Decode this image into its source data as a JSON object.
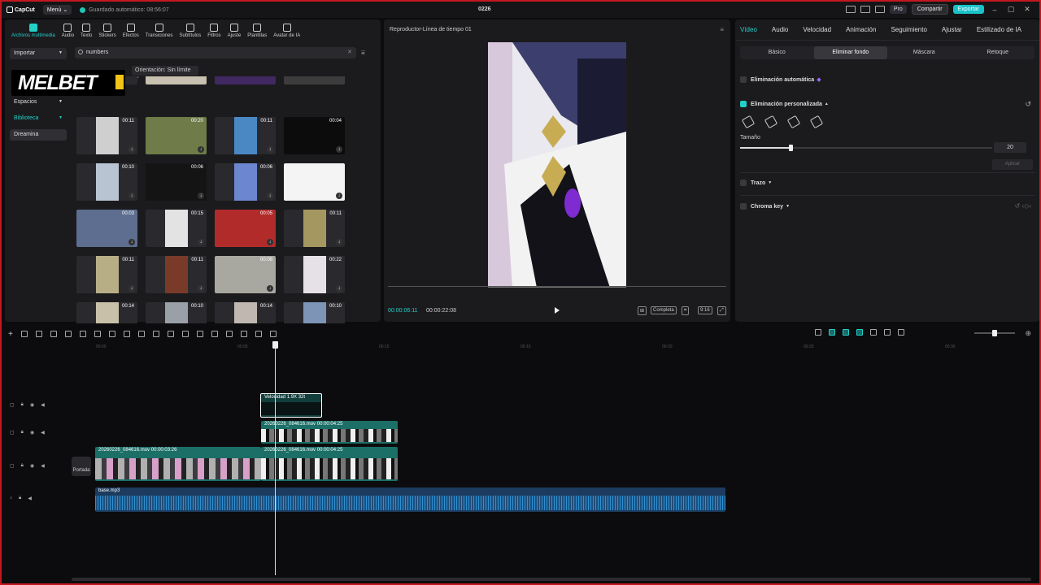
{
  "titlebar": {
    "app_name": "CapCut",
    "menu_label": "Menú",
    "autosave": "Guardado automático: 08:56:07",
    "project_title": "0226",
    "pro_label": "Pro",
    "share_label": "Compartir",
    "export_label": "Exportar"
  },
  "toolbar": {
    "items": [
      {
        "label": "Archivos multimedia",
        "icon": "media-icon",
        "active": true
      },
      {
        "label": "Audio",
        "icon": "audio-icon"
      },
      {
        "label": "Texto",
        "icon": "text-icon"
      },
      {
        "label": "Stickers",
        "icon": "sticker-icon"
      },
      {
        "label": "Efectos",
        "icon": "effects-icon"
      },
      {
        "label": "Transiciones",
        "icon": "transitions-icon"
      },
      {
        "label": "Subtítulos",
        "icon": "subtitles-icon"
      },
      {
        "label": "Filtros",
        "icon": "filters-icon"
      },
      {
        "label": "Ajuste",
        "icon": "adjust-icon"
      },
      {
        "label": "Plantillas",
        "icon": "templates-icon"
      },
      {
        "label": "Avatar de IA",
        "icon": "ai-avatar-icon"
      }
    ]
  },
  "sidebar": {
    "items": [
      {
        "label": "Importar"
      },
      {
        "label": "Espacios"
      },
      {
        "label": "Biblioteca"
      },
      {
        "label": "Dreamina"
      }
    ]
  },
  "search": {
    "value": "numbers"
  },
  "orientation": {
    "label": "Orientación: Sin límite"
  },
  "overlay_logo": {
    "text": "MELBET"
  },
  "media_thumbs": [
    {
      "dur": "00:11",
      "color": "#cfcfcf",
      "wide": false
    },
    {
      "dur": "00:20",
      "color": "#6f7b48",
      "wide": true
    },
    {
      "dur": "00:11",
      "color": "#4a88c4",
      "wide": false
    },
    {
      "dur": "00:04",
      "color": "#0c0c0c",
      "wide": true
    },
    {
      "dur": "00:10",
      "color": "#b9c4d2",
      "wide": false
    },
    {
      "dur": "00:06",
      "color": "#141414",
      "wide": true
    },
    {
      "dur": "00:06",
      "color": "#6c86d0",
      "wide": false
    },
    {
      "dur": "",
      "color": "#f4f4f4",
      "wide": true
    },
    {
      "dur": "00:03",
      "color": "#5d6e90",
      "wide": true
    },
    {
      "dur": "00:15",
      "color": "#e3e3e3",
      "wide": false
    },
    {
      "dur": "00:05",
      "color": "#b22b2b",
      "wide": true
    },
    {
      "dur": "00:11",
      "color": "#a59760",
      "wide": false
    },
    {
      "dur": "00:11",
      "color": "#b8ae86",
      "wide": false
    },
    {
      "dur": "00:11",
      "color": "#7a3a2a",
      "wide": false
    },
    {
      "dur": "00:08",
      "color": "#a8a8a0",
      "wide": true
    },
    {
      "dur": "00:22",
      "color": "#e6e1e6",
      "wide": false
    },
    {
      "dur": "00:14",
      "color": "#c8c0a8",
      "wide": false
    },
    {
      "dur": "00:10",
      "color": "#9aa0a8",
      "wide": false
    },
    {
      "dur": "00:14",
      "color": "#c0b8b0",
      "wide": false
    },
    {
      "dur": "00:10",
      "color": "#7e94b6",
      "wide": false
    }
  ],
  "player": {
    "title": "Reproductor-Línea de tiempo 01",
    "current_time": "00:00:06:11",
    "total_time": "00:00:22:08",
    "quality_label": "Completa",
    "ratio_label": "9:16"
  },
  "properties": {
    "tabs": [
      "Vídeo",
      "Audio",
      "Velocidad",
      "Animación",
      "Seguimiento",
      "Ajustar",
      "Estilizado de IA"
    ],
    "subtabs": [
      "Básico",
      "Eliminar fondo",
      "Máscara",
      "Retoque"
    ],
    "auto_remove": "Eliminación automática",
    "custom_remove": "Eliminación personalizada",
    "size_label": "Tamaño",
    "size_value": "20",
    "size_fraction": 0.2,
    "apply_label": "Aplicar",
    "stroke_label": "Trazo",
    "chroma_label": "Chroma key"
  },
  "timeline": {
    "ruler": [
      "00:00",
      "00:05",
      "00:10",
      "00:15",
      "00:20",
      "00:25",
      "00:30"
    ],
    "speed_clip_label": "Velocidad 1.9X  32t",
    "clip_upper_name": "20260226_084616.mov",
    "clip_upper_dur": "00:00:04:25",
    "clip_main_name": "20260226_084616.mov",
    "clip_main_dur": "00:00:03:26",
    "clip_main2_name": "20260226_084616.mov",
    "clip_main2_dur": "00:00:04:25",
    "audio_name": "base.mp3",
    "cover_label": "Portada"
  }
}
